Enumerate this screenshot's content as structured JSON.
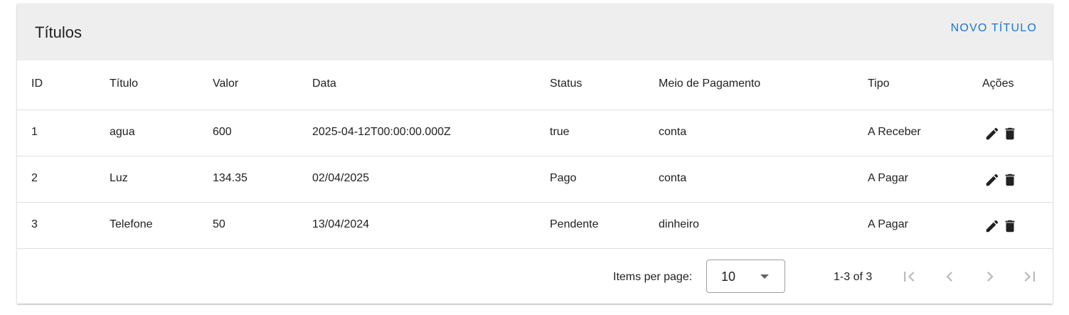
{
  "header": {
    "title": "Títulos",
    "new_button": "NOVO TÍTULO"
  },
  "table": {
    "columns": [
      "ID",
      "Título",
      "Valor",
      "Data",
      "Status",
      "Meio de Pagamento",
      "Tipo",
      "Ações"
    ],
    "rows": [
      [
        "1",
        "agua",
        "600",
        "2025-04-12T00:00:00.000Z",
        "true",
        "conta",
        "A Receber"
      ],
      [
        "2",
        "Luz",
        "134.35",
        "02/04/2025",
        "Pago",
        "conta",
        "A Pagar"
      ],
      [
        "3",
        "Telefone",
        "50",
        "13/04/2024",
        "Pendente",
        "dinheiro",
        "A Pagar"
      ]
    ],
    "row_actions": [
      "edit-icon",
      "delete-icon"
    ]
  },
  "paginator": {
    "items_per_page_label": "Items per page:",
    "items_per_page_value": "10",
    "range_label": "1-3 of 3",
    "nav_icons": [
      "first-page-icon",
      "previous-page-icon",
      "next-page-icon",
      "last-page-icon"
    ]
  },
  "colors": {
    "accent": "#1976d2",
    "header_bg": "#eeeeee",
    "disabled": "#bdbdbd"
  }
}
